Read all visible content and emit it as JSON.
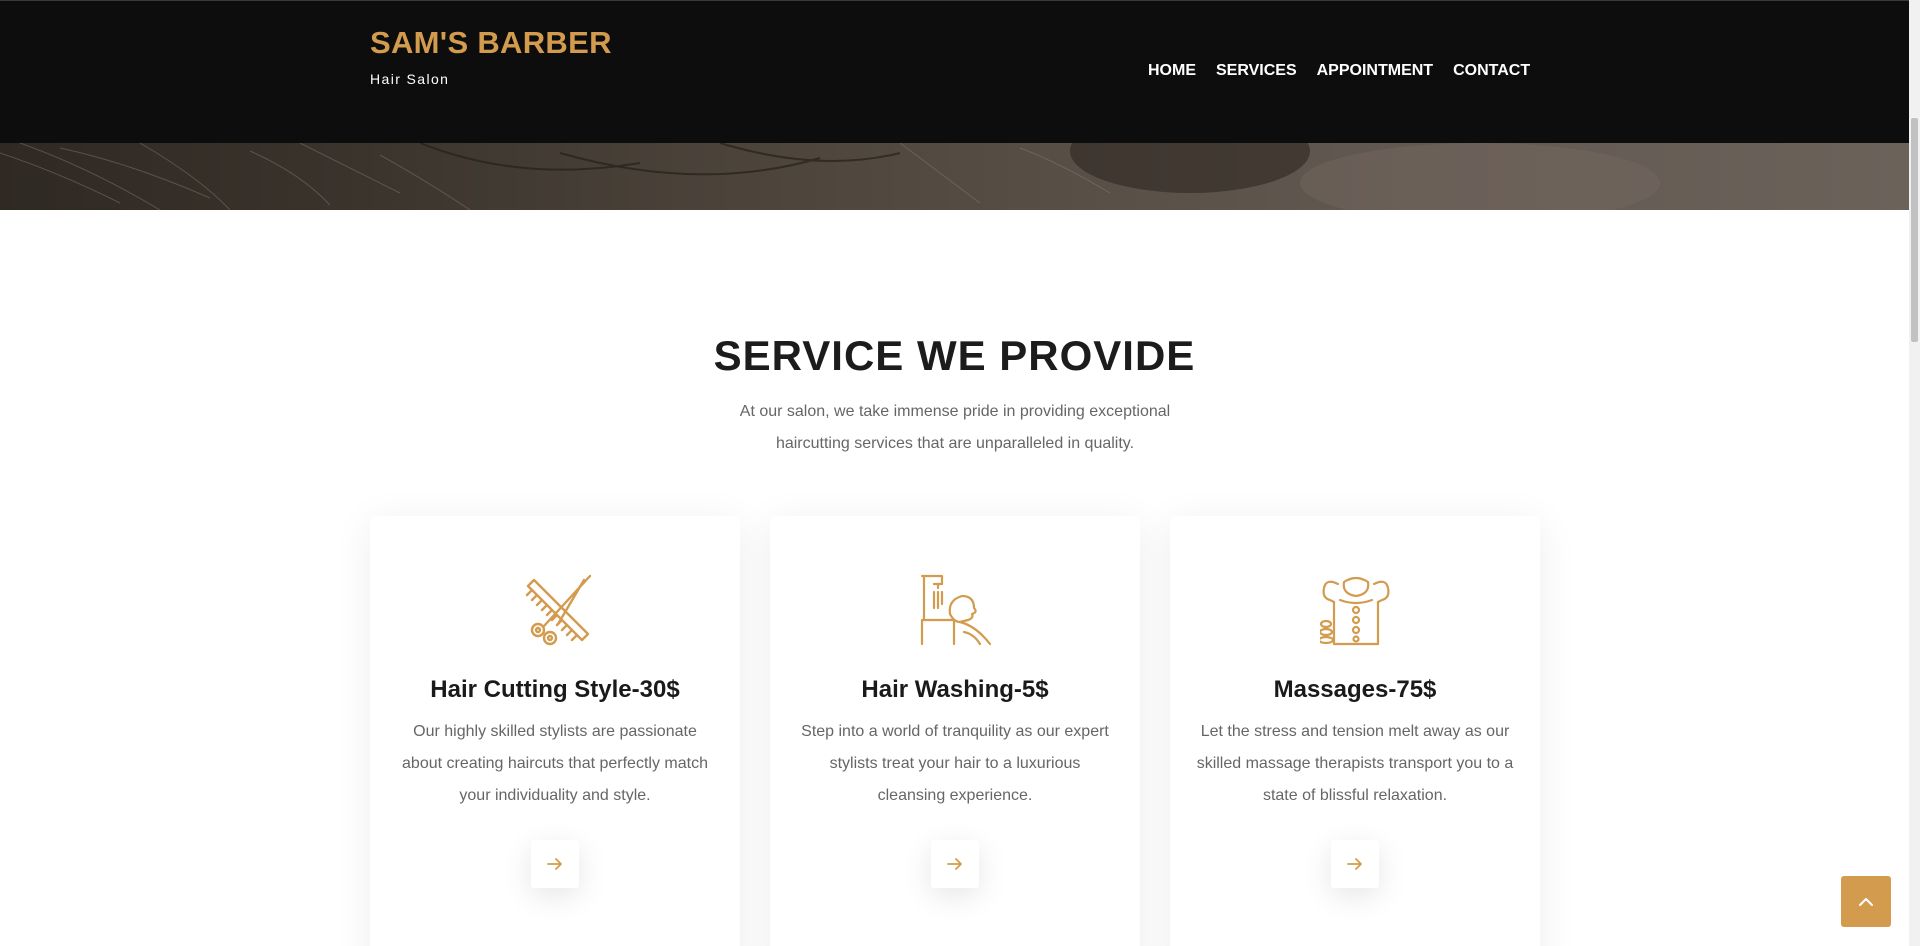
{
  "colors": {
    "accent": "#d39b4d",
    "header_bg": "#0d0d0d",
    "heading": "#1c1c1c",
    "body_text": "#666666"
  },
  "header": {
    "brand": "SAM'S BARBER",
    "tagline": "Hair Salon",
    "nav": [
      {
        "label": "HOME"
      },
      {
        "label": "SERVICES"
      },
      {
        "label": "APPOINTMENT"
      },
      {
        "label": "CONTACT"
      }
    ]
  },
  "section": {
    "title": "SERVICE WE PROVIDE",
    "intro": "At our salon, we take immense pride in providing exceptional haircutting services that are unparalleled in quality."
  },
  "services": [
    {
      "icon": "scissors-comb-icon",
      "title": "Hair Cutting Style-30$",
      "description": "Our highly skilled stylists are passionate about creating haircuts that perfectly match your individuality and style.",
      "link_icon": "arrow-right-icon"
    },
    {
      "icon": "hair-washing-icon",
      "title": "Hair Washing-5$",
      "description": "Step into a world of tranquility as our expert stylists treat your hair to a luxurious cleansing experience.",
      "link_icon": "arrow-right-icon"
    },
    {
      "icon": "massage-icon",
      "title": "Massages-75$",
      "description": "Let the stress and tension melt away as our skilled massage therapists transport you to a state of blissful relaxation.",
      "link_icon": "arrow-right-icon"
    }
  ],
  "back_to_top": {
    "icon": "chevron-up-icon"
  }
}
